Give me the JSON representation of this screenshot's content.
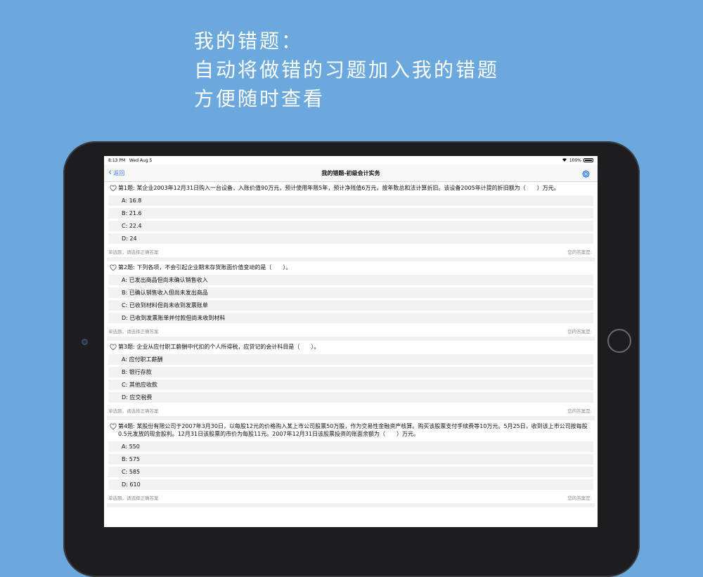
{
  "promo": {
    "line1": "我的错题：",
    "line2": "自动将做错的习题加入我的错题",
    "line3": "方便随时查看"
  },
  "status": {
    "time": "8:13 PM",
    "date": "Wed Aug 5",
    "battery": "100%"
  },
  "nav": {
    "back_label": "返回",
    "title": "我的错题-初级会计实务"
  },
  "colors": {
    "accent": "#2f7cf6",
    "background": "#6aa8de"
  },
  "footer": {
    "hint": "单选题，请选择正确答案",
    "your_answer": "您的答案是:"
  },
  "questions": [
    {
      "text": "第1题: 某企业2003年12月31日购入一台设备，入账价值90万元，预计使用年限5年，预计净残值6万元，按年数总和法计算折旧。该设备2005年计提的折旧额为（　　）万元。",
      "options": [
        "A: 16.8",
        "B: 21.6",
        "C: 22.4",
        "D: 24"
      ]
    },
    {
      "text": "第2题: 下列各项，不会引起企业期末存货账面价值变动的是（　　）。",
      "options": [
        "A: 已发出商品但尚未确认销售收入",
        "B: 已确认销售收入但尚未发出商品",
        "C: 已收到材料但尚未收到发票账单",
        "D: 已收到发票账单并付款但尚未收到材料"
      ]
    },
    {
      "text": "第3题: 企业从应付职工薪酬中代扣的个人所得税，应贷记的会计科目是（　　）。",
      "options": [
        "A: 应付职工薪酬",
        "B: 银行存款",
        "C: 其他应收款",
        "D: 应交税费"
      ]
    },
    {
      "text": "第4题: 某股份有限公司于2007年3月30日，以每股12元的价格购入某上市公司股票50万股，作为交易性金融资产核算。购买该股票支付手续费等10万元。5月25日，收到该上市公司按每股0.5元发放的现金股利。12月31日该股票的市价为每股11元。2007年12月31日该股票投资的账面余额为（　　）万元。",
      "options": [
        "A: 550",
        "B: 575",
        "C: 585",
        "D: 610"
      ]
    }
  ]
}
